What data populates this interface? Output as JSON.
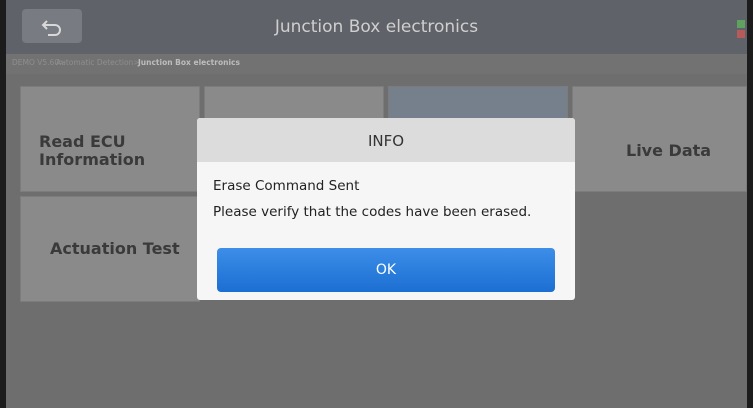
{
  "header": {
    "title": "Junction Box electronics",
    "back_icon": "back-arrow-icon",
    "status_icon": "connection-status-icon"
  },
  "breadcrumb": {
    "items": [
      "DEMO V5.60>",
      "Automatic Detection>",
      "Junction Box electronics"
    ]
  },
  "menu": {
    "tiles": [
      "Read ECU Information",
      "",
      "",
      "Live Data",
      "Actuation Test"
    ]
  },
  "dialog": {
    "title": "INFO",
    "message_line1": "Erase Command Sent",
    "message_line2": "Please verify that the codes have been erased.",
    "ok_label": "OK"
  },
  "colors": {
    "primary_button": "#1c6fd2",
    "header_bg": "#5f6268"
  }
}
